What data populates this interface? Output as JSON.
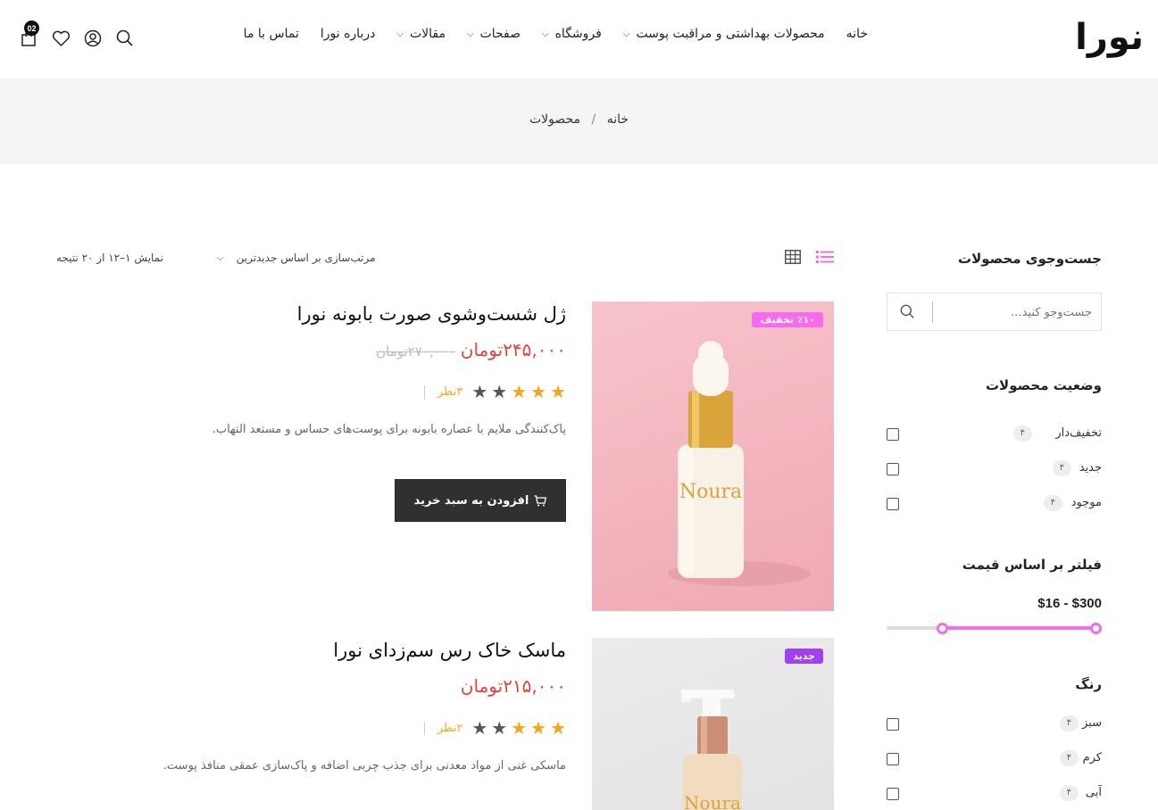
{
  "header": {
    "logo_text": "نورا",
    "nav": [
      {
        "label": "خانه",
        "has_dropdown": false
      },
      {
        "label": "محصولات بهداشتی و مراقبت پوست",
        "has_dropdown": false
      },
      {
        "label": "فروشگاه",
        "has_dropdown": true
      },
      {
        "label": "صفحات",
        "has_dropdown": true
      },
      {
        "label": "مقالات",
        "has_dropdown": true
      },
      {
        "label": "درباره نورا",
        "has_dropdown": false
      },
      {
        "label": "تماس با ما",
        "has_dropdown": false
      }
    ],
    "cart_count": "02",
    "icons": [
      "search-icon",
      "user-icon",
      "heart-icon",
      "cart-icon"
    ]
  },
  "breadcrumb": {
    "home": "خانه",
    "separator": "/",
    "current": "محصولات"
  },
  "sidebar": {
    "search_title": "جست‌وجوی محصولات",
    "search_placeholder": "جست‌وجو کنید...",
    "status_title": "وضعیت محصولات",
    "status_items": [
      {
        "label": "تخفیف‌دار",
        "count": "۴",
        "checked": false
      },
      {
        "label": "جدید",
        "count": "۴",
        "checked": false
      },
      {
        "label": "موجود",
        "count": "۴",
        "checked": false
      }
    ],
    "price_title": "فیلتر بر اساس قیمت",
    "price_range_text": "$16 - $300",
    "price_min_fraction": 0.0,
    "price_max_fraction": 0.74,
    "color_title": "رنگ",
    "color_items": [
      {
        "label": "سبز",
        "count": "۴",
        "checked": false
      },
      {
        "label": "کرم",
        "count": "۴",
        "checked": false
      },
      {
        "label": "آبی",
        "count": "۴",
        "checked": false
      }
    ]
  },
  "toolbar": {
    "sort_label": "مرتب‌سازی بر اساس جدیدترین",
    "result_text": "نمایش ۱–۱۲ از ۲۰ نتیجه",
    "active_view": "list"
  },
  "products": [
    {
      "title": "ژل شست‌وشوی صورت بابونه نورا",
      "price": "۲۴۵,۰۰۰تومان",
      "old_price": "۲۷۰,۰۰۰تومان",
      "rating": 3,
      "rating_max": 5,
      "reviews": "۳نظر",
      "description": "پاک‌کنندگی ملایم با عصاره بابونه برای پوست‌های حساس و مستعد التهاب.",
      "badge": "٪۱۰ تخفیف",
      "badge_color": "#f36cf0",
      "add_to_cart": "افزودن به سبد خرید",
      "bottle_text": "Noura"
    },
    {
      "title": "ماسک خاک رس سم‌زدای نورا",
      "price": "۲۱۵,۰۰۰تومان",
      "old_price": "",
      "rating": 3,
      "rating_max": 5,
      "reviews": "۲نظر",
      "description": "ماسکی غنی از مواد معدنی برای جذب چربی اضافه و پاک‌سازی عمقی منافذ پوست.",
      "badge": "جدید",
      "badge_color": "#a040f0",
      "bottle_text": "Noura"
    }
  ],
  "colors": {
    "accent": "#ee6ef0",
    "price": "#e0453d",
    "star": "#f4a51c",
    "button": "#303030"
  }
}
